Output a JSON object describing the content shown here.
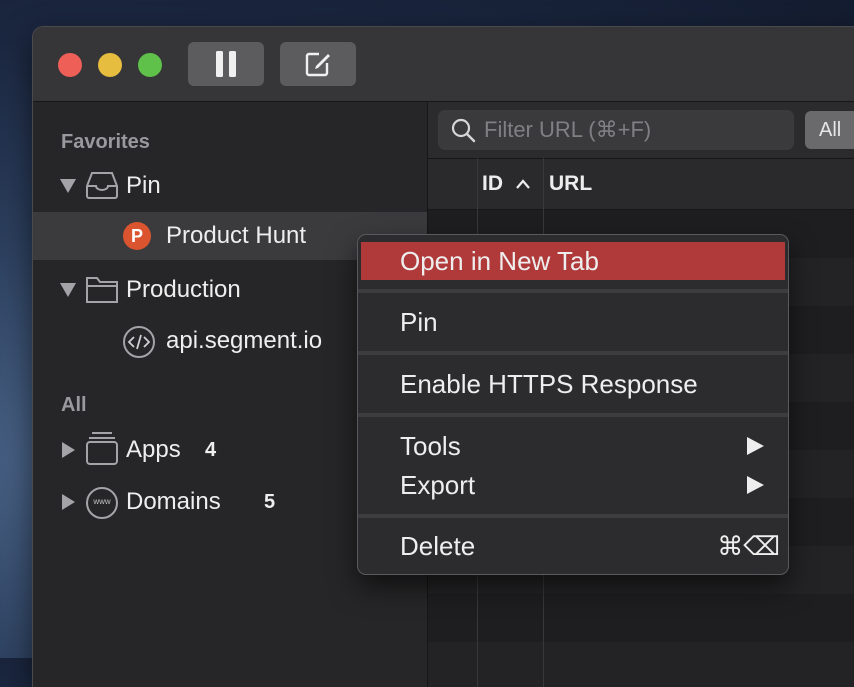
{
  "sidebar": {
    "favorites_title": "Favorites",
    "all_title": "All",
    "pin": {
      "label": "Pin",
      "icon": "tray-icon"
    },
    "product_hunt": {
      "label": "Product Hunt",
      "badge": "P",
      "badge_color": "#da552f"
    },
    "production": {
      "label": "Production",
      "icon": "folder-icon"
    },
    "api_segment": {
      "label": "api.segment.io",
      "icon": "code-icon"
    },
    "apps": {
      "label": "Apps",
      "count": "4"
    },
    "domains": {
      "label": "Domains",
      "count": "5",
      "icon_text": "www"
    }
  },
  "filter": {
    "placeholder": "Filter URL (⌘+F)",
    "all_label": "All"
  },
  "table": {
    "col_id": "ID",
    "col_url": "URL"
  },
  "context_menu": {
    "open_new_tab": "Open in New Tab",
    "pin": "Pin",
    "enable_https": "Enable HTTPS Response",
    "tools": "Tools",
    "export": "Export",
    "delete": "Delete",
    "delete_shortcut": "⌘⌫",
    "highlight_color": "#b03a3a"
  }
}
